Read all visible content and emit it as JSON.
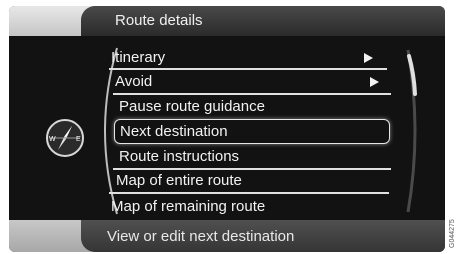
{
  "header": {
    "title": "Route details"
  },
  "menu": {
    "items": [
      {
        "label": "Itinerary",
        "has_submenu": true
      },
      {
        "label": "Avoid",
        "has_submenu": true
      },
      {
        "label": "Pause route guidance"
      },
      {
        "label": "Next destination",
        "selected": true
      },
      {
        "label": "Route instructions"
      },
      {
        "label": "Map of entire route"
      },
      {
        "label": "Map of remaining route"
      }
    ]
  },
  "compass": {
    "west": "W",
    "east": "E"
  },
  "footer": {
    "text": "View or edit next destination"
  },
  "side_code": "G044275",
  "colors": {
    "background": "#121212",
    "text": "#f2f2f2",
    "bar": "#3c3c3c"
  }
}
